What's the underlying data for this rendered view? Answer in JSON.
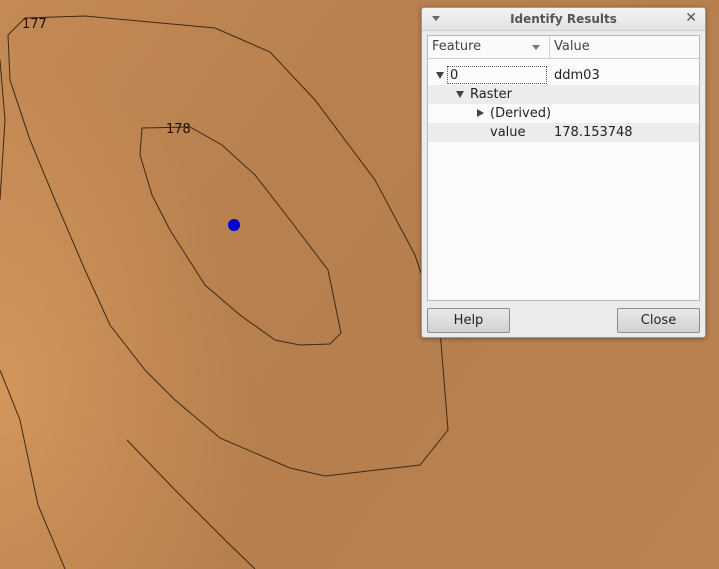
{
  "map": {
    "contour_labels": [
      "177",
      "178"
    ],
    "identify_point_color": "#0000cc"
  },
  "dialog": {
    "title": "Identify Results",
    "columns": {
      "feature": "Feature",
      "value": "Value"
    },
    "rows": [
      {
        "feature": "0",
        "value": "ddm03",
        "expanded": true
      },
      {
        "feature": "Raster",
        "value": "",
        "expanded": true
      },
      {
        "feature": "(Derived)",
        "value": "",
        "expanded": false
      },
      {
        "feature": "value",
        "value": "178.153748"
      }
    ],
    "buttons": {
      "help": "Help",
      "close": "Close"
    }
  }
}
